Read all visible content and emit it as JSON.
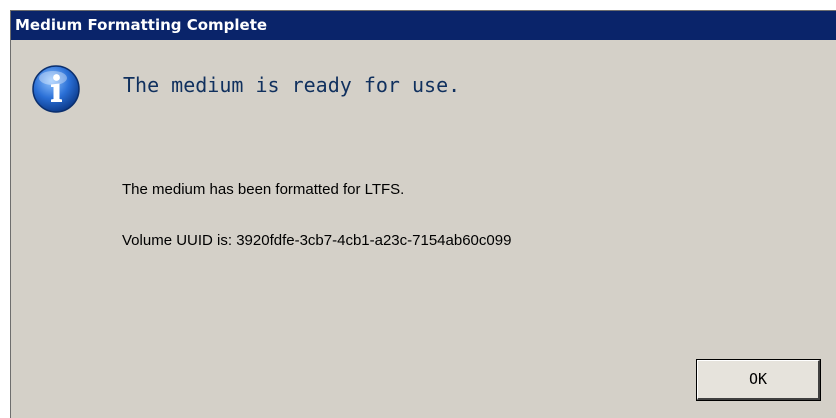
{
  "window": {
    "title": "Medium Formatting Complete"
  },
  "dialog": {
    "icon": "information-icon",
    "heading": "The medium is ready for use.",
    "message_formatted": "The medium has been formatted for LTFS.",
    "message_uuid": "Volume UUID is: 3920fdfe-3cb7-4cb1-a23c-7154ab60c099",
    "ok_label": "OK"
  },
  "colors": {
    "titlebar": "#0a246a",
    "dialog_background": "#d4d0c8",
    "heading_text": "#10305e",
    "icon_blue": "#1f5fbf"
  }
}
